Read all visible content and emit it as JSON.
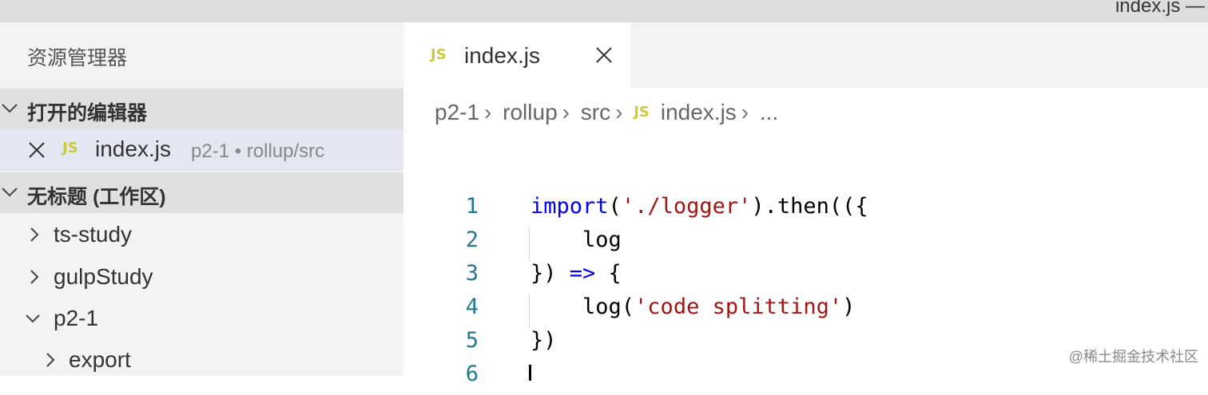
{
  "window": {
    "title": "index.js —"
  },
  "sidebar": {
    "header": "资源管理器",
    "open_editors": {
      "label": "打开的编辑器",
      "items": [
        {
          "icon": "JS",
          "name": "index.js",
          "description": "p2-1 • rollup/src"
        }
      ]
    },
    "workspace": {
      "label": "无标题 (工作区)",
      "tree": [
        {
          "label": "ts-study",
          "expanded": false
        },
        {
          "label": "gulpStudy",
          "expanded": false
        },
        {
          "label": "p2-1",
          "expanded": true
        },
        {
          "label": "export",
          "expanded": false
        }
      ]
    }
  },
  "editor": {
    "tab": {
      "icon": "JS",
      "name": "index.js"
    },
    "breadcrumb": [
      "p2-1",
      "rollup",
      "src",
      "index.js",
      "..."
    ],
    "breadcrumb_icon": "JS",
    "code_lines": [
      {
        "number": "1",
        "tokens": [
          {
            "t": "import",
            "c": "kw"
          },
          {
            "t": "("
          },
          {
            "t": "'./logger'",
            "c": "str"
          },
          {
            "t": ").then(({"
          }
        ]
      },
      {
        "number": "2",
        "tokens": [
          {
            "t": "    log"
          }
        ],
        "guide": true
      },
      {
        "number": "3",
        "tokens": [
          {
            "t": "}) "
          },
          {
            "t": "=>",
            "c": "kw"
          },
          {
            "t": " {"
          }
        ]
      },
      {
        "number": "4",
        "tokens": [
          {
            "t": "    log("
          },
          {
            "t": "'code splitting'",
            "c": "str"
          },
          {
            "t": ")"
          }
        ],
        "guide": true
      },
      {
        "number": "5",
        "tokens": [
          {
            "t": "})"
          }
        ]
      },
      {
        "number": "6",
        "tokens": []
      }
    ]
  },
  "watermark": "@稀土掘金技术社区",
  "colors": {
    "js_icon": "#cbcb41",
    "keyword": "#0000ff",
    "string": "#a31515",
    "line_number": "#237893"
  }
}
